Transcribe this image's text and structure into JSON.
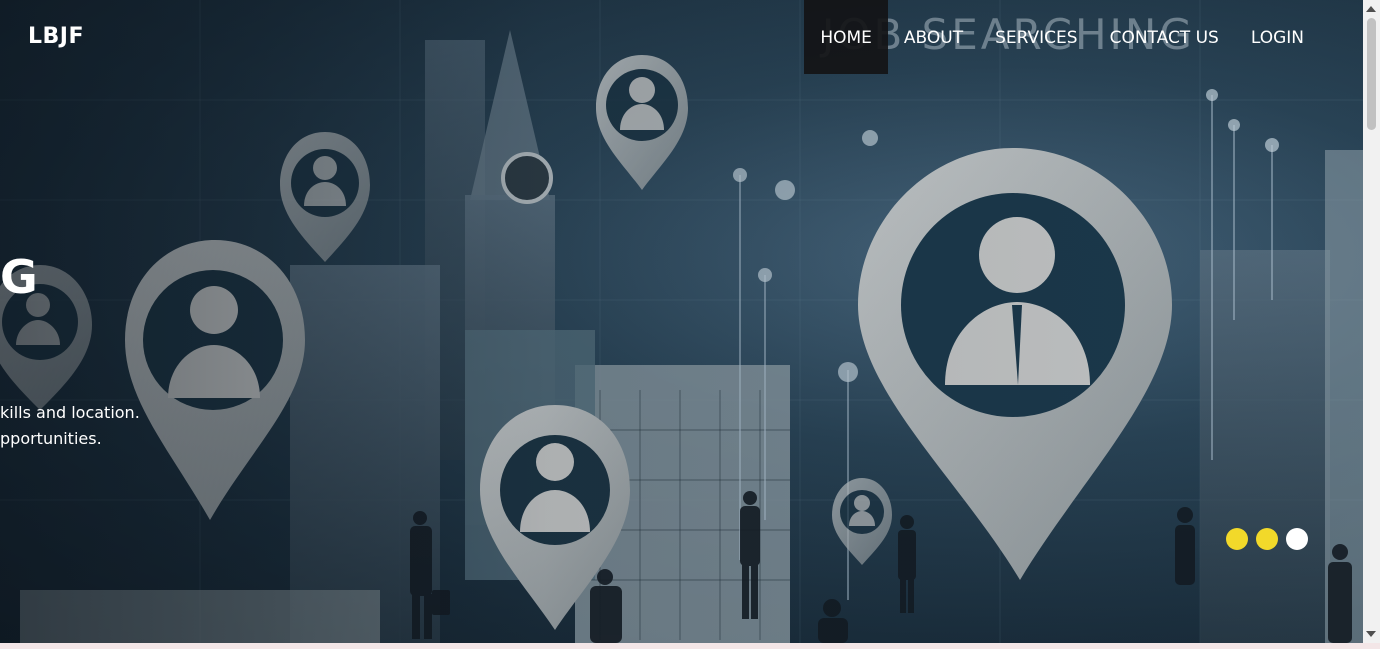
{
  "header": {
    "logo": "LBJF",
    "nav": [
      {
        "label": "HOME",
        "active": true
      },
      {
        "label": "ABOUT",
        "active": false
      },
      {
        "label": "SERVICES",
        "active": false
      },
      {
        "label": "CONTACT US",
        "active": false
      },
      {
        "label": "LOGIN",
        "active": false
      }
    ]
  },
  "hero": {
    "background_title": "JOB SEARCHING",
    "headline": "G",
    "subtext_line1": "kills and location.",
    "subtext_line2": "pportunities."
  },
  "carousel": {
    "dots": [
      {
        "color": "#f2d92a",
        "active": false
      },
      {
        "color": "#f2d92a",
        "active": false
      },
      {
        "color": "#ffffff",
        "active": true
      }
    ]
  },
  "colors": {
    "nav_active_bg": "#161618",
    "text": "#ffffff",
    "dot_inactive": "#f2d92a",
    "dot_active": "#ffffff"
  }
}
